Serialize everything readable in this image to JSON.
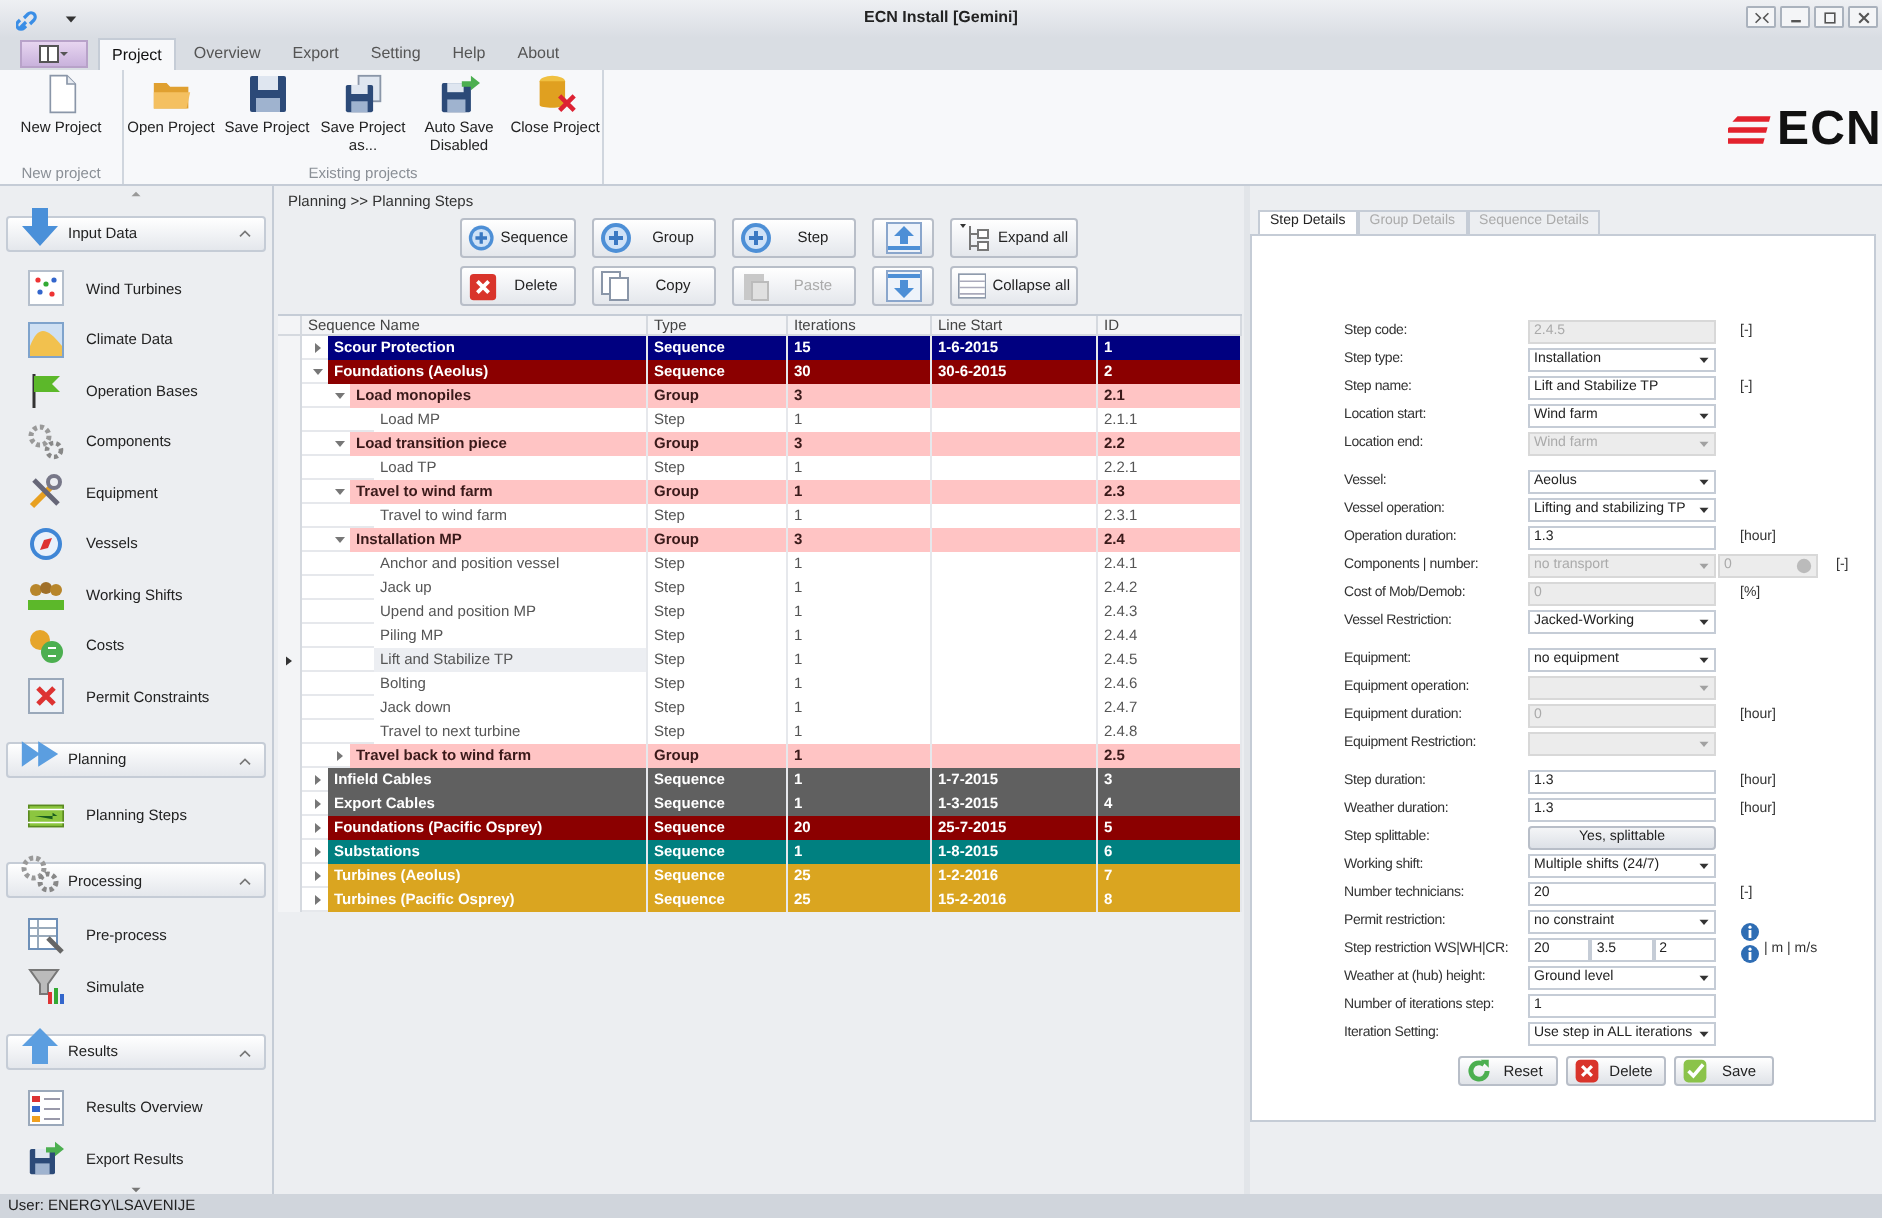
{
  "window": {
    "title": "ECN Install [Gemini]"
  },
  "ribbon": {
    "tabs": [
      {
        "label": "Project",
        "selected": true
      },
      {
        "label": "Overview",
        "selected": false
      },
      {
        "label": "Export",
        "selected": false
      },
      {
        "label": "Setting",
        "selected": false
      },
      {
        "label": "Help",
        "selected": false
      },
      {
        "label": "About",
        "selected": false
      }
    ],
    "groups": [
      {
        "title": "New project",
        "buttons": [
          "New Project"
        ]
      },
      {
        "title": "Existing projects",
        "buttons": [
          "Open Project",
          "Save Project",
          "Save Project as...",
          "Auto Save Disabled",
          "Close Project"
        ]
      }
    ],
    "logo": "ECN"
  },
  "sidebar": {
    "sections": [
      {
        "title": "Input Data",
        "expanded": true,
        "items": [
          "Wind Turbines",
          "Climate Data",
          "Operation Bases",
          "Components",
          "Equipment",
          "Vessels",
          "Working Shifts",
          "Costs",
          "Permit Constraints"
        ]
      },
      {
        "title": "Planning",
        "expanded": true,
        "items": [
          "Planning Steps"
        ]
      },
      {
        "title": "Processing",
        "expanded": true,
        "items": [
          "Pre-process",
          "Simulate"
        ]
      },
      {
        "title": "Results",
        "expanded": true,
        "items": [
          "Results Overview",
          "Export Results"
        ]
      }
    ]
  },
  "breadcrumb": "Planning >> Planning Steps",
  "toolbar": [
    {
      "kind": "add",
      "label": "Sequence",
      "disabled": false
    },
    {
      "kind": "add",
      "label": "Group",
      "disabled": false
    },
    {
      "kind": "add",
      "label": "Step",
      "disabled": false
    },
    {
      "kind": "up"
    },
    {
      "kind": "expand",
      "label": "Expand all",
      "disabled": false
    },
    {
      "kind": "delete",
      "label": "Delete",
      "disabled": false
    },
    {
      "kind": "copy",
      "label": "Copy",
      "disabled": false
    },
    {
      "kind": "paste",
      "label": "Paste",
      "disabled": true
    },
    {
      "kind": "down"
    },
    {
      "kind": "collapse",
      "label": "Collapse all",
      "disabled": false
    }
  ],
  "table": {
    "columns": [
      "Sequence Name",
      "Type",
      "Iterations",
      "Line Start",
      "ID"
    ],
    "rows": [
      {
        "kind": "sequence",
        "name": "Scour Protection",
        "type": "Sequence",
        "iterations": "15",
        "line_start": "1-6-2015",
        "id": "1",
        "color": "#000080",
        "expanded": false,
        "selected": false
      },
      {
        "kind": "sequence",
        "name": "Foundations (Aeolus)",
        "type": "Sequence",
        "iterations": "30",
        "line_start": "30-6-2015",
        "id": "2",
        "color": "#8b0000",
        "expanded": true,
        "selected": false,
        "children": [
          {
            "kind": "group",
            "name": "Load monopiles",
            "type": "Group",
            "iterations": "3",
            "id": "2.1",
            "expanded": true,
            "selected": false,
            "children": [
              {
                "kind": "step",
                "name": "Load MP",
                "type": "Step",
                "iterations": "1",
                "id": "2.1.1",
                "selected": false
              }
            ]
          },
          {
            "kind": "group",
            "name": "Load transition piece",
            "type": "Group",
            "iterations": "3",
            "id": "2.2",
            "expanded": true,
            "selected": false,
            "children": [
              {
                "kind": "step",
                "name": "Load TP",
                "type": "Step",
                "iterations": "1",
                "id": "2.2.1",
                "selected": false
              }
            ]
          },
          {
            "kind": "group",
            "name": "Travel to wind farm",
            "type": "Group",
            "iterations": "1",
            "id": "2.3",
            "expanded": true,
            "selected": false,
            "children": [
              {
                "kind": "step",
                "name": "Travel to wind farm",
                "type": "Step",
                "iterations": "1",
                "id": "2.3.1",
                "selected": false
              }
            ]
          },
          {
            "kind": "group",
            "name": "Installation MP",
            "type": "Group",
            "iterations": "3",
            "id": "2.4",
            "expanded": true,
            "selected": false,
            "children": [
              {
                "kind": "step",
                "name": "Anchor and position vessel",
                "type": "Step",
                "iterations": "1",
                "id": "2.4.1",
                "selected": false
              },
              {
                "kind": "step",
                "name": "Jack up",
                "type": "Step",
                "iterations": "1",
                "id": "2.4.2",
                "selected": false
              },
              {
                "kind": "step",
                "name": "Upend and position MP",
                "type": "Step",
                "iterations": "1",
                "id": "2.4.3",
                "selected": false
              },
              {
                "kind": "step",
                "name": "Piling MP",
                "type": "Step",
                "iterations": "1",
                "id": "2.4.4",
                "selected": false
              },
              {
                "kind": "step",
                "name": "Lift and Stabilize TP",
                "type": "Step",
                "iterations": "1",
                "id": "2.4.5",
                "selected": true
              },
              {
                "kind": "step",
                "name": "Bolting",
                "type": "Step",
                "iterations": "1",
                "id": "2.4.6",
                "selected": false
              },
              {
                "kind": "step",
                "name": "Jack down",
                "type": "Step",
                "iterations": "1",
                "id": "2.4.7",
                "selected": false
              },
              {
                "kind": "step",
                "name": "Travel to next turbine",
                "type": "Step",
                "iterations": "1",
                "id": "2.4.8",
                "selected": false
              }
            ]
          },
          {
            "kind": "group",
            "name": "Travel back to wind farm",
            "type": "Group",
            "iterations": "1",
            "id": "2.5",
            "expanded": false,
            "selected": false
          }
        ]
      },
      {
        "kind": "sequence",
        "name": "Infield Cables",
        "type": "Sequence",
        "iterations": "1",
        "line_start": "1-7-2015",
        "id": "3",
        "color": "#606060",
        "expanded": false,
        "selected": false
      },
      {
        "kind": "sequence",
        "name": "Export Cables",
        "type": "Sequence",
        "iterations": "1",
        "line_start": "1-3-2015",
        "id": "4",
        "color": "#606060",
        "expanded": false,
        "selected": false
      },
      {
        "kind": "sequence",
        "name": "Foundations (Pacific Osprey)",
        "type": "Sequence",
        "iterations": "20",
        "line_start": "25-7-2015",
        "id": "5",
        "color": "#8b0000",
        "expanded": false,
        "selected": false
      },
      {
        "kind": "sequence",
        "name": "Substations",
        "type": "Sequence",
        "iterations": "1",
        "line_start": "1-8-2015",
        "id": "6",
        "color": "#008080",
        "expanded": false,
        "selected": false
      },
      {
        "kind": "sequence",
        "name": "Turbines (Aeolus)",
        "type": "Sequence",
        "iterations": "25",
        "line_start": "1-2-2016",
        "id": "7",
        "color": "#daa520",
        "expanded": false,
        "selected": false
      },
      {
        "kind": "sequence",
        "name": "Turbines (Pacific Osprey)",
        "type": "Sequence",
        "iterations": "25",
        "line_start": "15-2-2016",
        "id": "8",
        "color": "#daa520",
        "expanded": false,
        "selected": false
      }
    ]
  },
  "details": {
    "tabs": [
      {
        "label": "Step Details",
        "selected": true
      },
      {
        "label": "Group Details",
        "selected": false
      },
      {
        "label": "Sequence Details",
        "selected": false
      }
    ],
    "sections": [
      [
        {
          "label": "Step code:",
          "kind": "text",
          "value": "2.4.5",
          "disabled": true,
          "unit": "[-]"
        },
        {
          "label": "Step type:",
          "kind": "select",
          "value": "Installation",
          "disabled": false
        },
        {
          "label": "Step name:",
          "kind": "text",
          "value": "Lift and Stabilize TP",
          "disabled": false,
          "unit": "[-]"
        },
        {
          "label": "Location start:",
          "kind": "select",
          "value": "Wind farm",
          "disabled": false
        },
        {
          "label": "Location end:",
          "kind": "select",
          "value": "Wind farm",
          "disabled": true
        }
      ],
      [
        {
          "label": "Vessel:",
          "kind": "select",
          "value": "Aeolus",
          "disabled": false
        },
        {
          "label": "Vessel operation:",
          "kind": "select",
          "value": "Lifting and stabilizing TP",
          "disabled": false
        },
        {
          "label": "Operation duration:",
          "kind": "text",
          "value": "1.3",
          "disabled": false,
          "unit": "[hour]"
        },
        {
          "label": "Components | number:",
          "kind": "select_spin",
          "value": "no transport",
          "number": "0",
          "disabled": true,
          "unit": "[-]"
        },
        {
          "label": "Cost of Mob/Demob:",
          "kind": "text",
          "value": "0",
          "disabled": true,
          "unit": "[%]"
        },
        {
          "label": "Vessel Restriction:",
          "kind": "select",
          "value": "Jacked-Working",
          "disabled": false
        }
      ],
      [
        {
          "label": "Equipment:",
          "kind": "select",
          "value": "no equipment",
          "disabled": false
        },
        {
          "label": "Equipment operation:",
          "kind": "select",
          "disabled": true
        },
        {
          "label": "Equipment duration:",
          "kind": "text",
          "value": "0",
          "disabled": true,
          "unit": "[hour]"
        },
        {
          "label": "Equipment Restriction:",
          "kind": "select",
          "disabled": true
        }
      ],
      [
        {
          "label": "Step duration:",
          "kind": "text",
          "value": "1.3",
          "disabled": false,
          "unit": "[hour]"
        },
        {
          "label": "Weather duration:",
          "kind": "text",
          "value": "1.3",
          "disabled": false,
          "unit": "[hour]"
        },
        {
          "label": "Step splittable:",
          "kind": "button",
          "value": "Yes, splittable",
          "disabled": false
        },
        {
          "label": "Working shift:",
          "kind": "select",
          "value": "Multiple shifts (24/7)",
          "disabled": false
        },
        {
          "label": "Number technicians:",
          "kind": "text",
          "value": "20",
          "disabled": false,
          "unit": "[-]"
        },
        {
          "label": "Permit restriction:",
          "kind": "select",
          "value": "no constraint",
          "disabled": false,
          "info": true
        },
        {
          "label": "Step restriction WS|WH|CR:",
          "kind": "triple",
          "values": [
            "20",
            "3.5",
            "2"
          ],
          "disabled": false,
          "unit": "| m | m/s",
          "info": true
        },
        {
          "label": "Weather at (hub) height:",
          "kind": "select",
          "value": "Ground level",
          "disabled": false
        },
        {
          "label": "Number of iterations step:",
          "kind": "text",
          "value": "1",
          "disabled": false
        },
        {
          "label": "Iteration Setting:",
          "kind": "select",
          "value": "Use step in ALL iterations",
          "disabled": false
        }
      ]
    ],
    "actions": [
      {
        "kind": "reset",
        "label": "Reset"
      },
      {
        "kind": "delete",
        "label": "Delete"
      },
      {
        "kind": "save",
        "label": "Save"
      }
    ]
  },
  "status_bar": "User: ENERGY\\LSAVENIJE"
}
